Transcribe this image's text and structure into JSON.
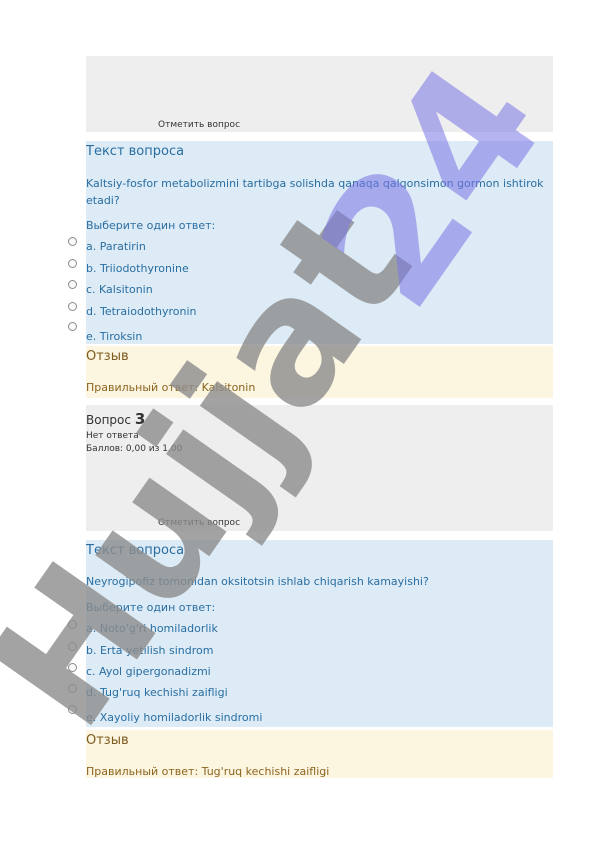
{
  "q2": {
    "flag_label": "Отметить вопрос",
    "section_title": "Текст вопроса",
    "question_text": "Kaltsiy-fosfor metabolizmini tartibga solishda qanaqa qalqonsimon gormon ishtirok etadi?",
    "prompt": "Выберите один ответ:",
    "answers": [
      "a. Paratirin",
      "b. Triiodothyronine",
      "c. Kalsitonin",
      "d. Tetraiodothyronin",
      "e. Tiroksin"
    ],
    "feedback_title": "Отзыв",
    "feedback_text": "Правильный ответ: Kalsitonin"
  },
  "q3": {
    "label": "Вопрос",
    "number": "3",
    "status": "Нет ответа",
    "grade": "Баллов: 0,00 из 1,00",
    "flag_label": "Отметить вопрос",
    "section_title": "Текст вопроса",
    "question_text": "Neyrogipofiz tomonidan oksitotsin ishlab chiqarish kamayishi?",
    "prompt": "Выберите один ответ:",
    "answers": [
      "a. Noto'g'ri homiladorlik",
      "b. Erta yetilish sindrom",
      "c. Ayol gipergonadizmi",
      "d. Tug'ruq kechishi zaifligi",
      "e. Xayoliy homiladorlik sindromi"
    ],
    "feedback_title": "Отзыв",
    "feedback_text": "Правильный ответ: Tug'ruq kechishi zaifligi"
  },
  "watermark": {
    "text_grey": "Hujjat",
    "text_blue": "24"
  },
  "colors": {
    "formulation_bg": "#dcebf5",
    "info_bg": "#eeeeee",
    "feedback_bg": "#fcf5e0",
    "text_blue": "#2a6ea2",
    "feedback_text": "#8b6420",
    "watermark_grey": "#8c8c8c",
    "watermark_blue": "#7a74e6"
  }
}
